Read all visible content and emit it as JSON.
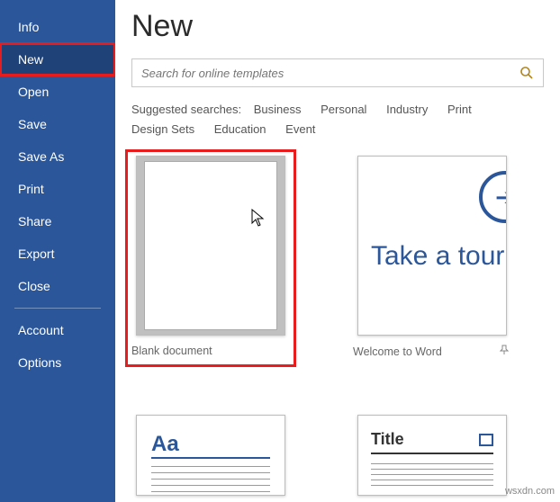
{
  "sidebar": {
    "items": [
      {
        "label": "Info"
      },
      {
        "label": "New"
      },
      {
        "label": "Open"
      },
      {
        "label": "Save"
      },
      {
        "label": "Save As"
      },
      {
        "label": "Print"
      },
      {
        "label": "Share"
      },
      {
        "label": "Export"
      },
      {
        "label": "Close"
      }
    ],
    "footer": [
      {
        "label": "Account"
      },
      {
        "label": "Options"
      }
    ],
    "selected_index": 1
  },
  "main": {
    "title": "New",
    "search_placeholder": "Search for online templates",
    "suggested_label": "Suggested searches:",
    "suggested": [
      "Business",
      "Personal",
      "Industry",
      "Print",
      "Design Sets",
      "Education",
      "Event"
    ],
    "templates": [
      {
        "label": "Blank document",
        "kind": "blank",
        "selected": true
      },
      {
        "label": "Welcome to Word",
        "kind": "tour",
        "tour_text": "Take a tour",
        "pinned": false
      },
      {
        "label": "",
        "kind": "spacing",
        "preview_text": "Aa"
      },
      {
        "label": "",
        "kind": "title",
        "preview_text": "Title"
      }
    ]
  },
  "watermark": "wsxdn.com"
}
